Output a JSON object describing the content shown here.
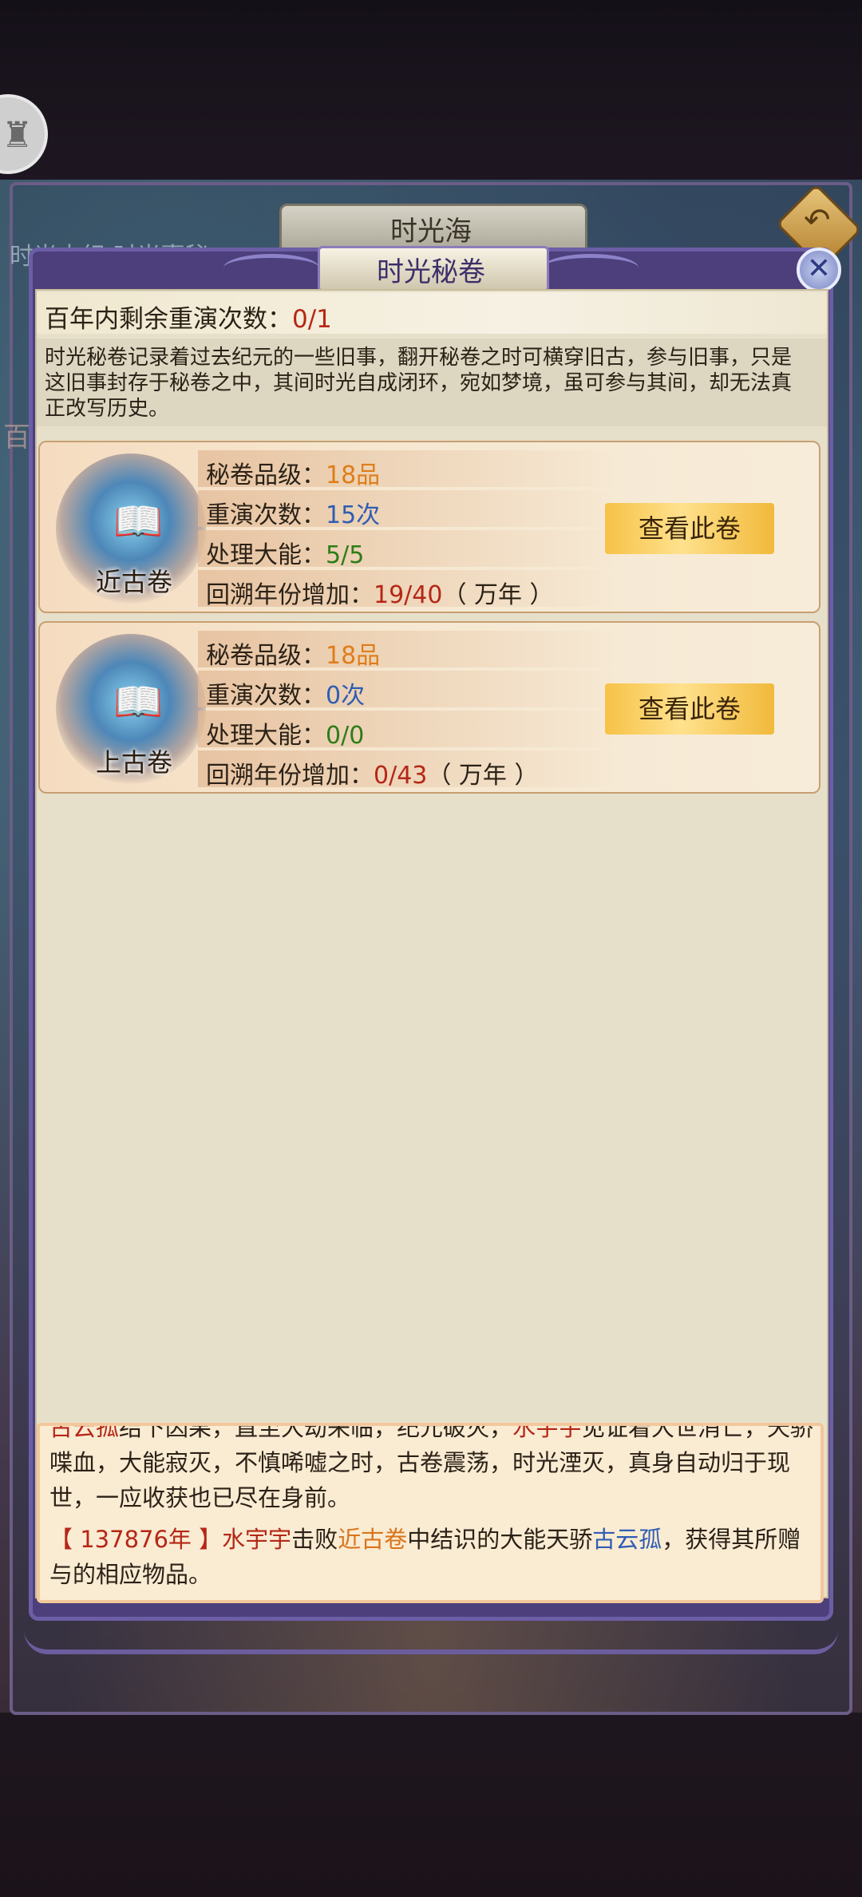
{
  "outer": {
    "title": "时光海",
    "ghost_tabs": "时光本纪  时光壹秘",
    "ghost_side": "百"
  },
  "panel": {
    "title": "时光秘卷",
    "remain_label": "百年内剩余重演次数：",
    "remain_value": "0/1",
    "description": "时光秘卷记录着过去纪元的一些旧事，翻开秘卷之时可横穿旧古，参与旧事，只是这旧事封存于秘卷之中，其间时光自成闭环，宛如梦境，虽可参与其间，却无法真正改写历史。"
  },
  "scrolls": [
    {
      "name": "近古卷",
      "grade_label": "秘卷品级：",
      "grade_value": "18品",
      "replay_label": "重演次数：",
      "replay_value": "15次",
      "handle_label": "处理大能：",
      "handle_value": "5/5",
      "years_label": "回溯年份增加：",
      "years_value": "19/40",
      "years_unit": "（ 万年 ）",
      "button": "查看此卷"
    },
    {
      "name": "上古卷",
      "grade_label": "秘卷品级：",
      "grade_value": "18品",
      "replay_label": "重演次数：",
      "replay_value": "0次",
      "handle_label": "处理大能：",
      "handle_value": "0/0",
      "years_label": "回溯年份增加：",
      "years_value": "0/43",
      "years_unit": "（ 万年 ）",
      "button": "查看此卷"
    }
  ],
  "log": {
    "line1_a": "古云孤",
    "line1_b": "结下因果，直至大劫来临，纪元破灭，",
    "line1_c": "水宇宇",
    "line1_d": "见证着大世消亡，天骄喋血，大能寂灭，不慎唏嘘之时，古卷震荡，时光湮灭，真身自动归于现世，一应收获也已尽在身前。",
    "entry_year": "【 137876年 】",
    "entry_player": "水宇宇",
    "entry_t1": "击败",
    "entry_scroll": "近古卷",
    "entry_t2": "中结识的大能天骄",
    "entry_npc": "古云孤",
    "entry_t3": "，获得其所赠与的相应物品。"
  },
  "colors": {
    "accent_red": "#b52716",
    "accent_orange": "#df7d18",
    "accent_blue": "#2f5db3",
    "accent_green": "#2c7d18"
  },
  "icons": {
    "back": "back-arrow-icon",
    "close": "close-icon",
    "avatar": "avatar-icon",
    "scroll": "scroll-emblem-icon"
  }
}
